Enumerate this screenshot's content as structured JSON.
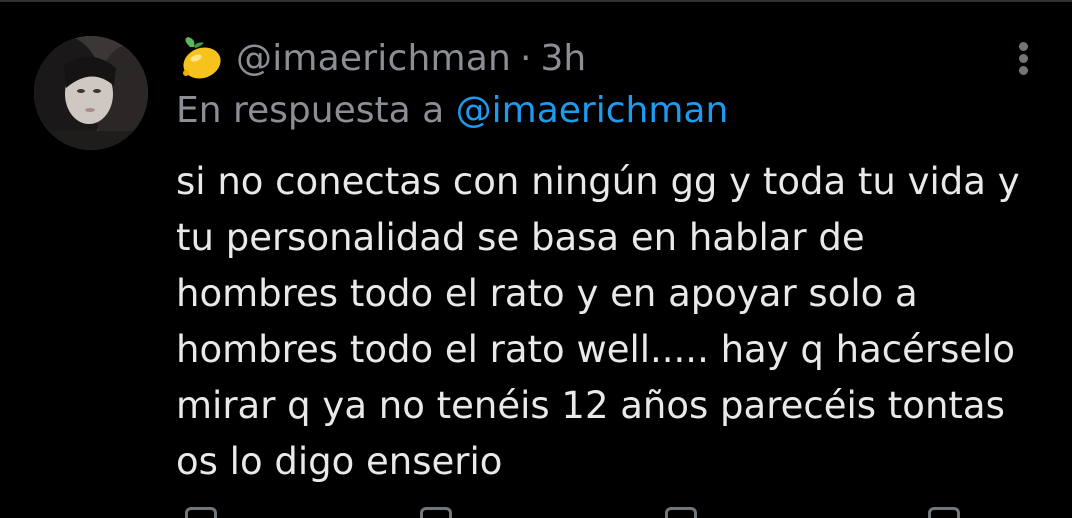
{
  "tweet": {
    "handle": "@imaerichman",
    "separator": "·",
    "time": "3h",
    "reply_prefix": "En respuesta a",
    "reply_to": "@imaerichman",
    "text_lines": [
      "si no conectas con ningún gg y toda tu vida y",
      "tu personalidad se basa en hablar de",
      "hombres todo el rato y en apoyar solo a",
      "hombres todo el rato well..... hay q hacérselo",
      "mirar q ya no tenéis 12 años parecéis tontas",
      "os lo digo enserio"
    ],
    "emoji_icon": "lemon-icon",
    "more_icon": "more-vertical-icon"
  },
  "colors": {
    "background": "#000000",
    "text": "#e7e9ea",
    "secondary_text": "#8b8f95",
    "link": "#1d9bf0"
  }
}
